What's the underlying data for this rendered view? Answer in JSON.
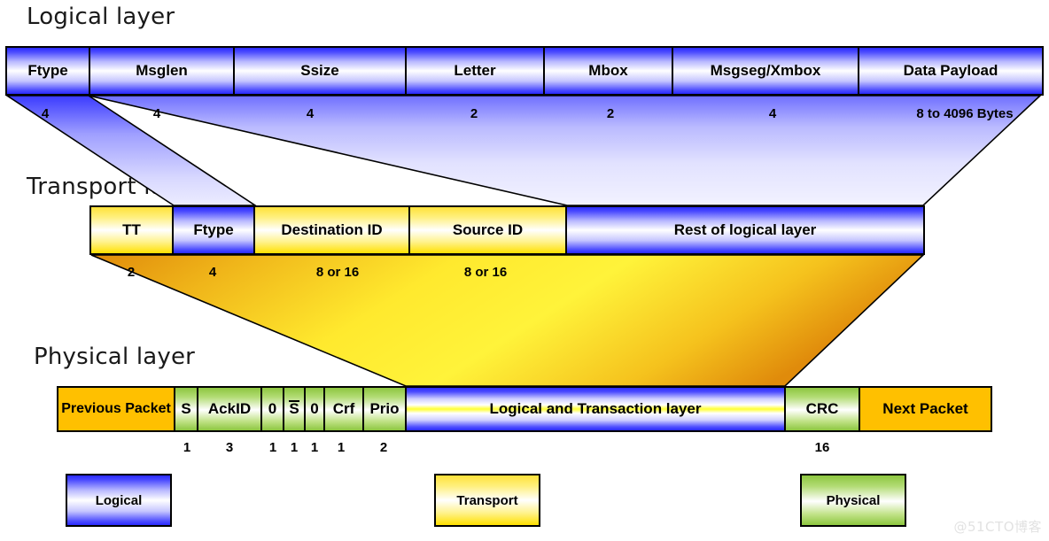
{
  "diagram": {
    "watermark": "@51CTO博客"
  },
  "logical": {
    "title": "Logical layer",
    "fields": [
      {
        "label": "Ftype",
        "size": "4"
      },
      {
        "label": "Msglen",
        "size": "4"
      },
      {
        "label": "Ssize",
        "size": "4"
      },
      {
        "label": "Letter",
        "size": "2"
      },
      {
        "label": "Mbox",
        "size": "2"
      },
      {
        "label": "Msgseg/Xmbox",
        "size": "4"
      },
      {
        "label": "Data Payload",
        "size": "8 to 4096 Bytes"
      }
    ]
  },
  "transport": {
    "title": "Transport layer",
    "fields": [
      {
        "label": "TT",
        "size": "2"
      },
      {
        "label": "Ftype",
        "size": "4"
      },
      {
        "label": "Destination ID",
        "size": "8 or 16"
      },
      {
        "label": "Source ID",
        "size": "8 or 16"
      },
      {
        "label": "Rest of logical layer",
        "size": ""
      }
    ]
  },
  "physical": {
    "title": "Physical layer",
    "fields": [
      {
        "label": "Previous Packet",
        "size": ""
      },
      {
        "label": "S",
        "size": "1"
      },
      {
        "label": "AckID",
        "size": "3"
      },
      {
        "label": "0",
        "size": "1"
      },
      {
        "label": "S",
        "size": "1"
      },
      {
        "label": "0",
        "size": "1"
      },
      {
        "label": "Crf",
        "size": "1"
      },
      {
        "label": "Prio",
        "size": "2"
      },
      {
        "label": "Logical and Transaction layer",
        "size": ""
      },
      {
        "label": "CRC",
        "size": "16"
      },
      {
        "label": "Next Packet",
        "size": ""
      }
    ]
  },
  "legend": {
    "items": [
      {
        "label": "Logical",
        "color": "#3333ff"
      },
      {
        "label": "Transport",
        "color": "#ffe000"
      },
      {
        "label": "Physical",
        "color": "#8dc63f"
      }
    ]
  }
}
